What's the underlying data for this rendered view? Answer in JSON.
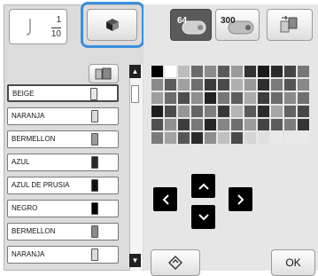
{
  "counter": {
    "current": "1",
    "total": "10"
  },
  "threads": [
    {
      "name": "BEIGE",
      "selected": true,
      "spool": "#e8e8e8"
    },
    {
      "name": "NARANJA",
      "selected": false,
      "spool": "#dcdcdc"
    },
    {
      "name": "BERMELLON",
      "selected": false,
      "spool": "#9a9a9a"
    },
    {
      "name": "AZUL",
      "selected": false,
      "spool": "#2a2a2a"
    },
    {
      "name": "AZUL DE PRUSIA",
      "selected": false,
      "spool": "#111111"
    },
    {
      "name": "NEGRO",
      "selected": false,
      "spool": "#000000"
    },
    {
      "name": "BERMELLON",
      "selected": false,
      "spool": "#8a8a8a"
    },
    {
      "name": "NARANJA",
      "selected": false,
      "spool": "#dcdcdc"
    }
  ],
  "toolbar": {
    "size64": "64",
    "size300": "300"
  },
  "ok_label": "OK",
  "palette_rows": [
    [
      "#000000",
      "#ffffff",
      "#bdbdbd",
      "#6a6a6a",
      "#8c8c8c",
      "#5a5a5a",
      "#9a9a9a",
      "#333333",
      "#1a1a1a",
      "#2a2a2a",
      "#444444",
      "#777777"
    ],
    [
      "#8a8a8a",
      "#5c5c5c",
      "#a0a0a0",
      "#6e6e6e",
      "#3a3a3a",
      "#4a4a4a",
      "#b0b0b0",
      "#999999",
      "#2e2e2e",
      "#7a7a7a",
      "#555555",
      "#888888"
    ],
    [
      "#9e9e9e",
      "#6c6c6c",
      "#4e4e4e",
      "#8e8e8e",
      "#222222",
      "#767676",
      "#5e5e5e",
      "#aaaaaa",
      "#3c3c3c",
      "#6a6a6a",
      "#8a8a8a",
      "#707070"
    ],
    [
      "#1e1e1e",
      "#4c4c4c",
      "#969696",
      "#646464",
      "#7e7e7e",
      "#383838",
      "#b4b4b4",
      "#5a5a5a",
      "#2c2c2c",
      "#a6a6a6",
      "#626262",
      "#484848"
    ],
    [
      "#505050",
      "#909090",
      "#3e3e3e",
      "#787878",
      "#262626",
      "#868686",
      "#6e6e6e",
      "#9c9c9c",
      "#444444",
      "#5c5c5c",
      "#7c7c7c",
      "#343434"
    ],
    [
      "#7a7a7a",
      "#a2a2a2",
      "#565656",
      "#2a2a2a",
      "#8e8e8e",
      "#c0c0c0",
      "#4a4a4a",
      "#d6d6d6",
      "#e0e0e0",
      "#e8e8e8",
      "#e8e8e8",
      "#e8e8e8"
    ]
  ]
}
